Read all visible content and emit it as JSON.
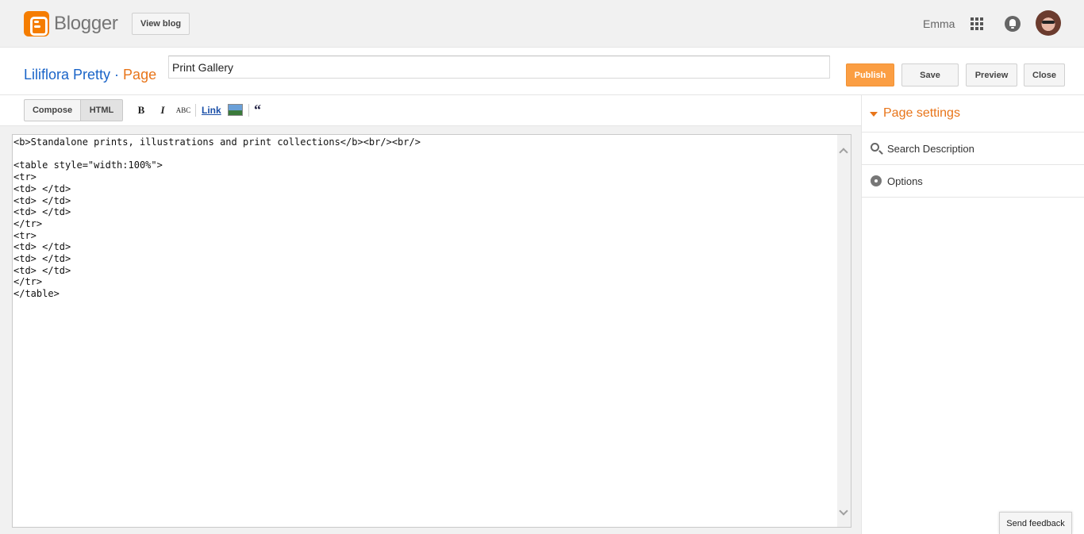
{
  "header": {
    "app_name": "Blogger",
    "view_blog_label": "View blog",
    "username": "Emma",
    "accent_color": "#f57d00"
  },
  "post": {
    "blog_name": "Liliflora Pretty",
    "separator": " · ",
    "kind": "Page",
    "title_value": "Print Gallery"
  },
  "actions": {
    "publish": "Publish",
    "save": "Save",
    "preview": "Preview",
    "close": "Close"
  },
  "toolbar": {
    "compose": "Compose",
    "html": "HTML",
    "bold": "B",
    "italic": "I",
    "spellcheck": "ABC",
    "link": "Link",
    "quote": "“"
  },
  "editor": {
    "mode": "HTML",
    "code": "<b>Standalone prints, illustrations and print collections</b><br/><br/>\n\n<table style=\"width:100%\">\n<tr>\n<td> </td>\n<td> </td>\n<td> </td>\n</tr>\n<tr>\n<td> </td>\n<td> </td>\n<td> </td>\n</tr>\n</table>"
  },
  "sidebar": {
    "title": "Page settings",
    "items": [
      {
        "label": "Search Description",
        "icon": "search-icon"
      },
      {
        "label": "Options",
        "icon": "gear-icon"
      }
    ]
  },
  "feedback_label": "Send feedback"
}
